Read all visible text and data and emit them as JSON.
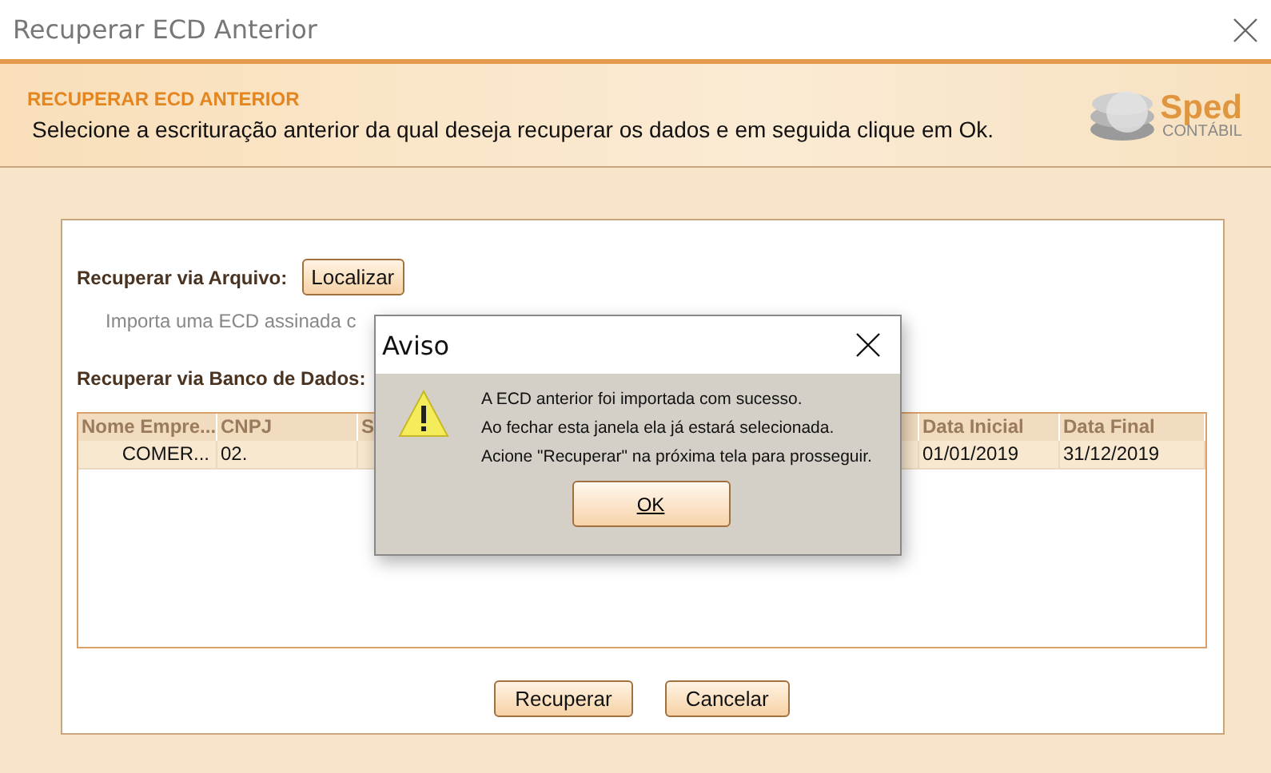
{
  "window": {
    "title": "Recuperar ECD Anterior"
  },
  "header": {
    "title": "RECUPERAR ECD ANTERIOR",
    "subtitle": "Selecione a escrituração anterior da qual deseja recuperar os dados e em seguida clique em Ok.",
    "logo": {
      "name": "Sped",
      "tagline": "CONTÁBIL"
    }
  },
  "file_section": {
    "label": "Recuperar via Arquivo:",
    "button": "Localizar",
    "hint": "Importa uma ECD assinada c"
  },
  "db_section": {
    "label": "Recuperar via Banco de Dados:"
  },
  "table": {
    "columns": [
      "Nome Empre...",
      "CNPJ",
      "S",
      "Data Inicial",
      "Data Final"
    ],
    "rows": [
      {
        "selected": true,
        "cells": [
          "COMER...",
          "02.",
          "",
          "01/01/2019",
          "31/12/2019"
        ]
      }
    ]
  },
  "buttons": [
    "Recuperar",
    "Cancelar"
  ],
  "dialog": {
    "title": "Aviso",
    "lines": [
      "A ECD anterior foi importada com sucesso.",
      "Ao fechar esta janela ela já estará selecionada.",
      "Acione \"Recuperar\" na próxima tela para prosseguir."
    ],
    "button": "OK"
  }
}
